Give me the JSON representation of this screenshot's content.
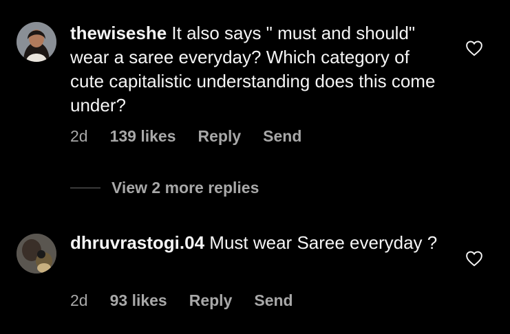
{
  "comments": [
    {
      "username": "thewiseshe",
      "text": "It also says \" must and should\" wear a saree everyday? Which category of cute capitalistic understanding does this come under?",
      "time": "2d",
      "likes": "139 likes",
      "reply": "Reply",
      "send": "Send"
    },
    {
      "username": "dhruvrastogi.04",
      "text": "Must wear Saree everyday ?",
      "time": "2d",
      "likes": "93 likes",
      "reply": "Reply",
      "send": "Send"
    }
  ],
  "view_replies": "View 2 more replies",
  "icons": {
    "like": "heart-icon"
  },
  "colors": {
    "background": "#000000",
    "text": "#f5f5f5",
    "muted": "#a8a8a8"
  }
}
